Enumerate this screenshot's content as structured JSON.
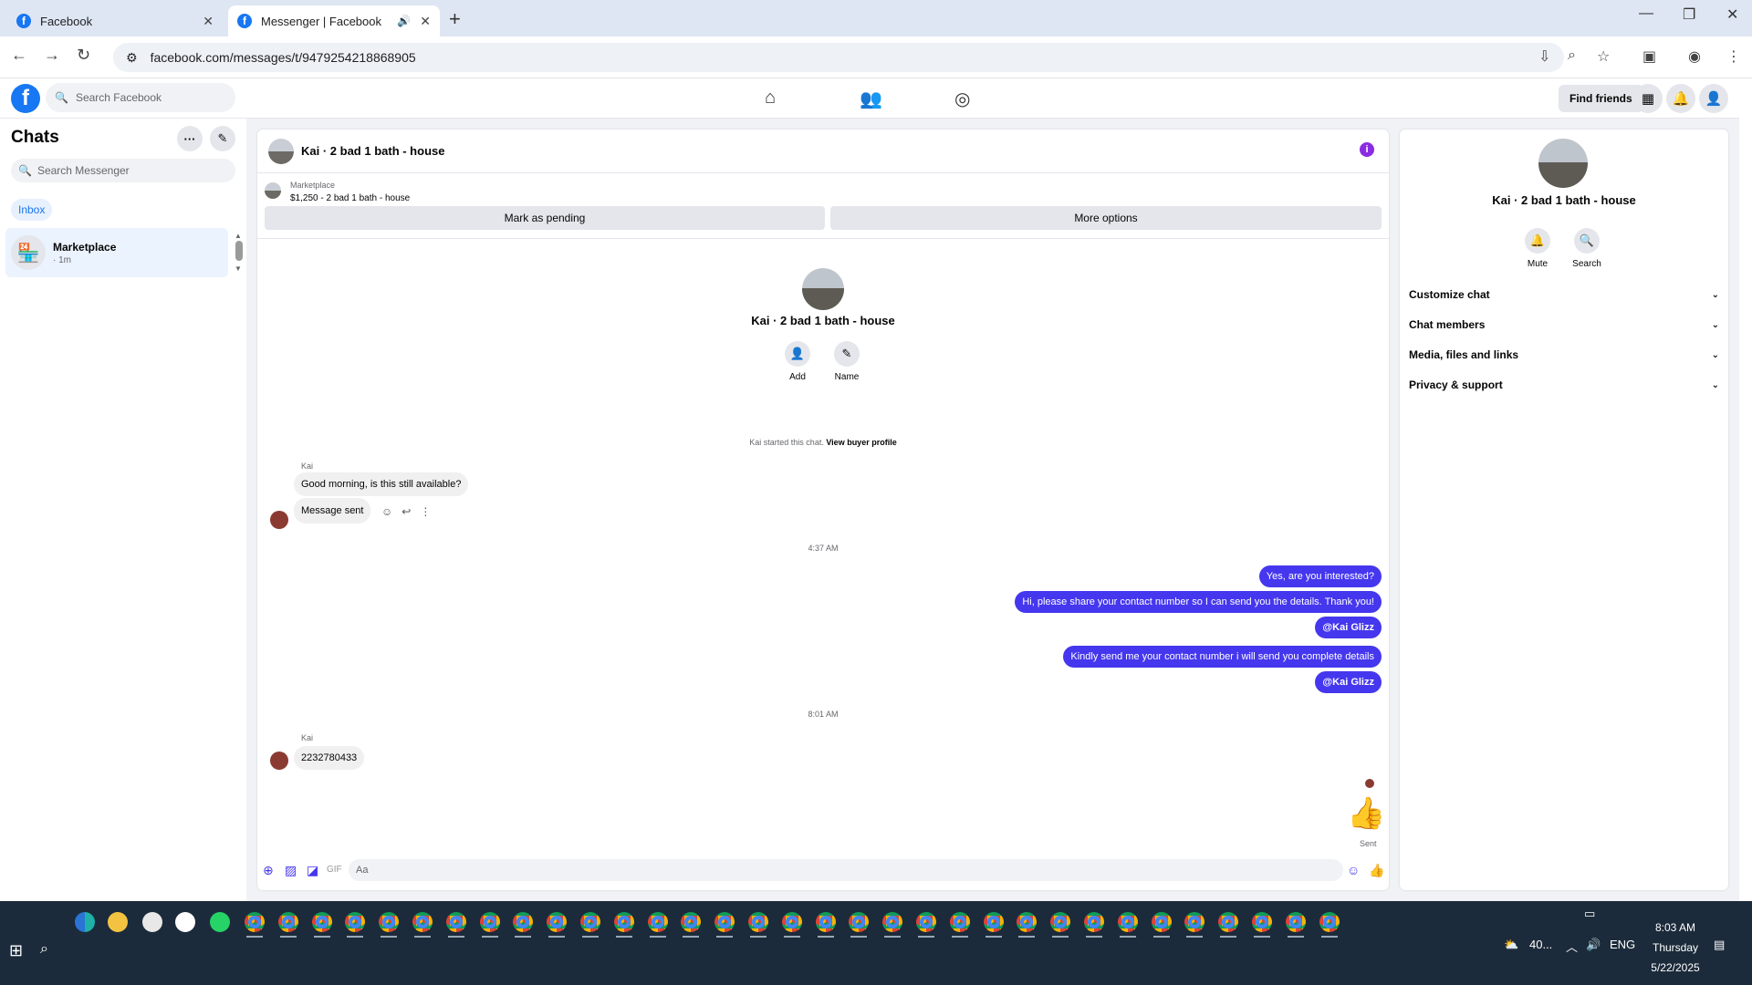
{
  "browser": {
    "tabs": [
      {
        "title": "Facebook",
        "favicon": "facebook-icon",
        "active": false
      },
      {
        "title": "Messenger | Facebook",
        "favicon": "facebook-icon",
        "active": true
      }
    ],
    "url": "facebook.com/messages/t/9479254218868905"
  },
  "header": {
    "logo": "f",
    "search_placeholder": "Search Facebook",
    "find_friends": "Find friends"
  },
  "sidebar": {
    "title": "Chats",
    "search_placeholder": "Search Messenger",
    "filter": "Inbox",
    "chats": [
      {
        "name": "Marketplace",
        "time": "· 1m"
      }
    ]
  },
  "conversation": {
    "title": "Kai · 2 bad 1 bath - house",
    "marketplace_label": "Marketplace",
    "listing": "$1,250 - 2 bad 1 bath - house",
    "mark_pending": "Mark as pending",
    "more_options": "More options",
    "intro_name": "Kai · 2 bad 1 bath - house",
    "intro_actions": [
      {
        "label": "Add",
        "icon": "add-person-icon"
      },
      {
        "label": "Name",
        "icon": "pencil-icon"
      }
    ],
    "started_text": "Kai started this chat.",
    "started_link": "View buyer profile",
    "sender": "Kai",
    "incoming_1": "Good morning, is this still available?",
    "incoming_2": "Message sent",
    "time_1": "4:37 AM",
    "outgoing": [
      {
        "text": "Yes, are you interested?",
        "bold": false
      },
      {
        "text": "Hi, please share your contact number so I can send you the details. Thank you!",
        "bold": false
      },
      {
        "text": "@Kai Glizz",
        "bold": true
      },
      {
        "text": "Kindly send me your contact number i will send you complete details",
        "bold": false
      },
      {
        "text": "@Kai Glizz",
        "bold": true
      }
    ],
    "time_2": "8:01 AM",
    "sender_2": "Kai",
    "incoming_3": "2232780433",
    "sent_status": "Sent",
    "composer_placeholder": "Aa"
  },
  "details": {
    "name": "Kai · 2 bad 1 bath - house",
    "actions": [
      {
        "label": "Mute",
        "icon": "bell-icon"
      },
      {
        "label": "Search",
        "icon": "search-icon"
      }
    ],
    "sections": [
      "Customize chat",
      "Chat members",
      "Media, files and links",
      "Privacy & support"
    ]
  },
  "taskbar": {
    "weather": "40...",
    "language": "ENG",
    "time": "8:03 AM",
    "day": "Thursday",
    "date": "5/22/2025"
  },
  "colors": {
    "accent": "#1877f2",
    "outgoing_bubble": "#4537ee",
    "info": "#8a2ce2"
  }
}
